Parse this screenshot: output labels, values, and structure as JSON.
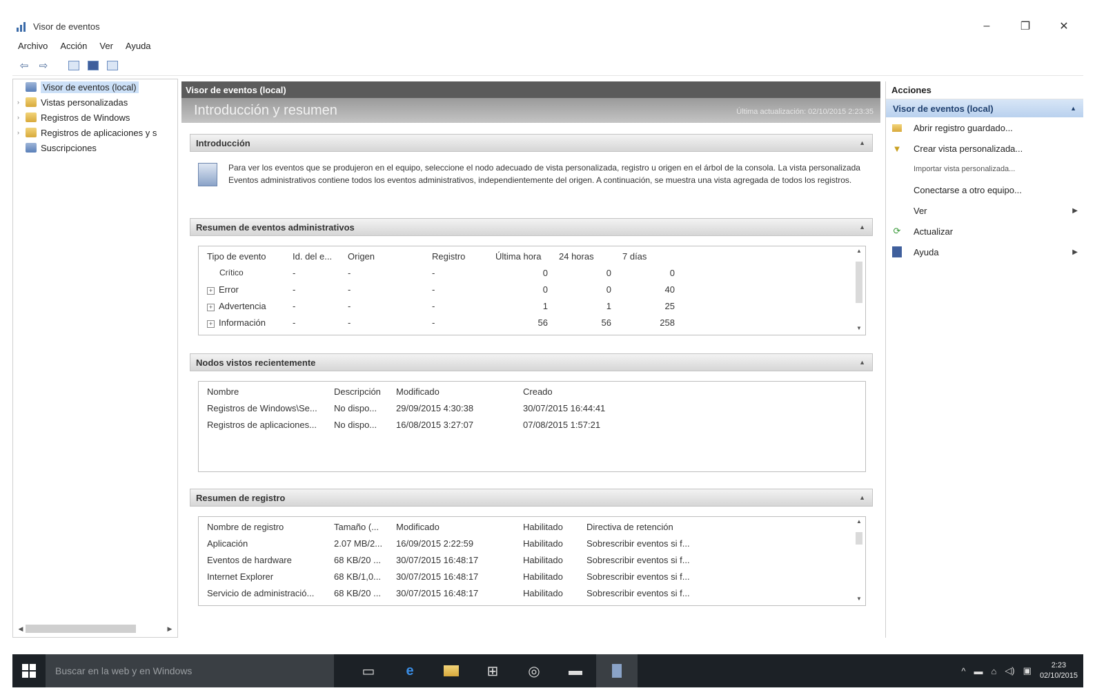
{
  "window": {
    "title": "Visor de eventos",
    "controls": {
      "minimize": "–",
      "restore": "❐",
      "close": "✕"
    }
  },
  "menu": [
    "Archivo",
    "Acción",
    "Ver",
    "Ayuda"
  ],
  "tree": {
    "items": [
      {
        "label": "Visor de eventos (local)",
        "icon": "event-viewer-icon",
        "selected": true
      },
      {
        "label": "Vistas personalizadas",
        "icon": "folder-icon"
      },
      {
        "label": "Registros de Windows",
        "icon": "folder-icon"
      },
      {
        "label": "Registros de aplicaciones y s",
        "icon": "folder-icon"
      },
      {
        "label": "Suscripciones",
        "icon": "subscriptions-icon"
      }
    ]
  },
  "center": {
    "header": "Visor de eventos (local)",
    "subheader": "Introducción y resumen",
    "hint": "Última actualización: 02/10/2015 2:23:35",
    "intro": {
      "title": "Introducción",
      "text": "Para ver los eventos que se produjeron en el equipo, seleccione el nodo adecuado de vista personalizada, registro u origen en el árbol de la consola. La vista personalizada Eventos administrativos contiene todos los eventos administrativos, independientemente del origen. A continuación, se muestra una vista agregada de todos los registros."
    },
    "summary": {
      "title": "Resumen de eventos administrativos",
      "columns": [
        "Tipo de evento",
        "Id. del e...",
        "Origen",
        "Registro",
        "Última hora",
        "24 horas",
        "7 días"
      ],
      "rows": [
        [
          "Crítico",
          "-",
          "-",
          "-",
          "0",
          "0",
          "0"
        ],
        [
          "Error",
          "-",
          "-",
          "-",
          "0",
          "0",
          "40"
        ],
        [
          "Advertencia",
          "-",
          "-",
          "-",
          "1",
          "1",
          "25"
        ],
        [
          "Información",
          "-",
          "-",
          "-",
          "56",
          "56",
          "258"
        ]
      ]
    },
    "recent": {
      "title": "Nodos vistos recientemente",
      "columns": [
        "Nombre",
        "Descripción",
        "Modificado",
        "Creado"
      ],
      "rows": [
        [
          "Registros de Windows\\Se...",
          "No dispo...",
          "29/09/2015 4:30:38",
          "30/07/2015 16:44:41"
        ],
        [
          "Registros de aplicaciones...",
          "No dispo...",
          "16/08/2015 3:27:07",
          "07/08/2015 1:57:21"
        ]
      ]
    },
    "logs": {
      "title": "Resumen de registro",
      "columns": [
        "Nombre de registro",
        "Tamaño (...",
        "Modificado",
        "Habilitado",
        "Directiva de retención"
      ],
      "rows": [
        [
          "Aplicación",
          "2.07 MB/2...",
          "16/09/2015 2:22:59",
          "Habilitado",
          "Sobrescribir eventos si f..."
        ],
        [
          "Eventos de hardware",
          "68 KB/20 ...",
          "30/07/2015 16:48:17",
          "Habilitado",
          "Sobrescribir eventos si f..."
        ],
        [
          "Internet Explorer",
          "68 KB/1,0...",
          "30/07/2015 16:48:17",
          "Habilitado",
          "Sobrescribir eventos si f..."
        ],
        [
          "Servicio de administració...",
          "68 KB/20 ...",
          "30/07/2015 16:48:17",
          "Habilitado",
          "Sobrescribir eventos si f..."
        ]
      ]
    }
  },
  "actions": {
    "title": "Acciones",
    "group": "Visor de eventos (local)",
    "items": [
      {
        "label": "Abrir registro guardado...",
        "icon": "folder-open-icon"
      },
      {
        "label": "Crear vista personalizada...",
        "icon": "filter-icon"
      },
      {
        "label": "Importar vista personalizada...",
        "icon": ""
      },
      {
        "label": "Conectarse a otro equipo...",
        "icon": ""
      },
      {
        "label": "Ver",
        "icon": "",
        "submenu": true
      },
      {
        "label": "Actualizar",
        "icon": "refresh-icon"
      },
      {
        "label": "Ayuda",
        "icon": "help-icon",
        "submenu": true
      }
    ]
  },
  "taskbar": {
    "search_placeholder": "Buscar en la web y en Windows",
    "clock_time": "2:23",
    "clock_date": "02/10/2015"
  }
}
